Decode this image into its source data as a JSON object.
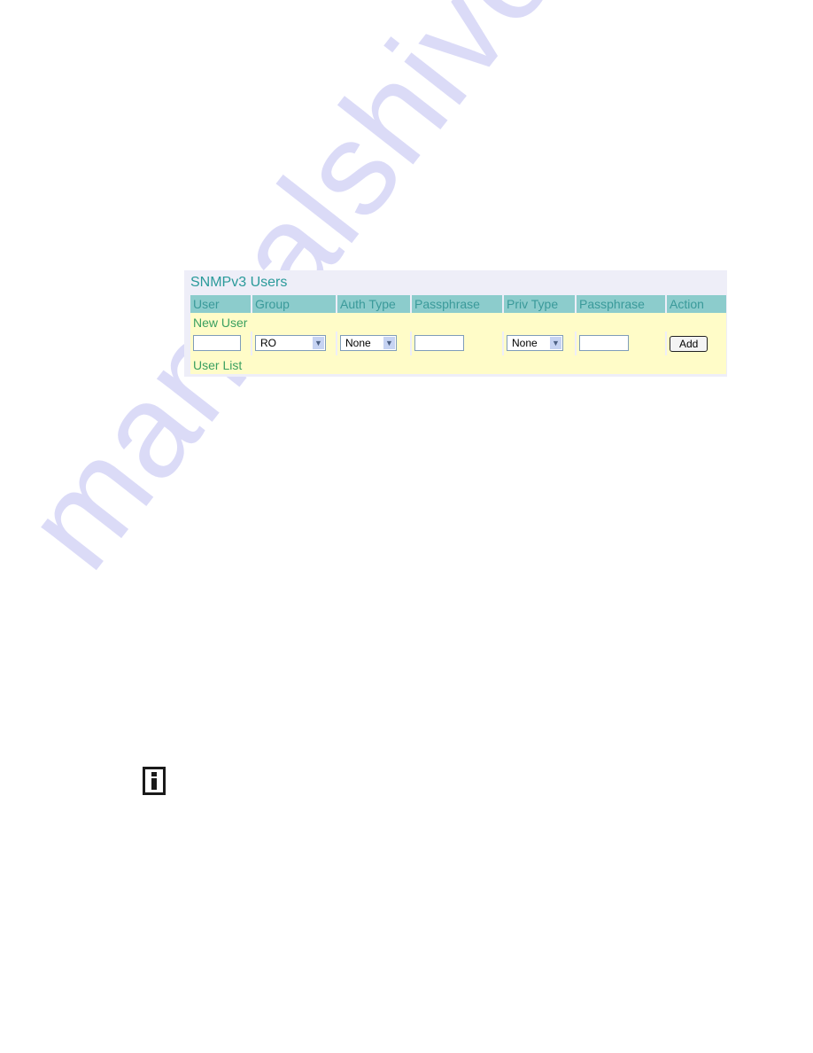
{
  "watermark": "manualshive.com",
  "panel": {
    "title": "SNMPv3 Users",
    "columns": [
      "User",
      "Group",
      "Auth Type",
      "Passphrase",
      "Priv Type",
      "Passphrase",
      "Action"
    ],
    "new_user_label": "New User",
    "user_list_label": "User List",
    "inputs": {
      "user_value": "",
      "group_selected": "RO",
      "auth_type_selected": "None",
      "auth_passphrase_value": "",
      "priv_type_selected": "None",
      "priv_passphrase_value": ""
    },
    "add_label": "Add"
  },
  "note": {
    "icon": "info-note-icon"
  },
  "colors": {
    "header_bg": "#8ccccc",
    "header_text": "#3a9a9a",
    "row_bg": "#fffcc8",
    "label_text": "#3aa060",
    "title": "#2a9a9a"
  }
}
